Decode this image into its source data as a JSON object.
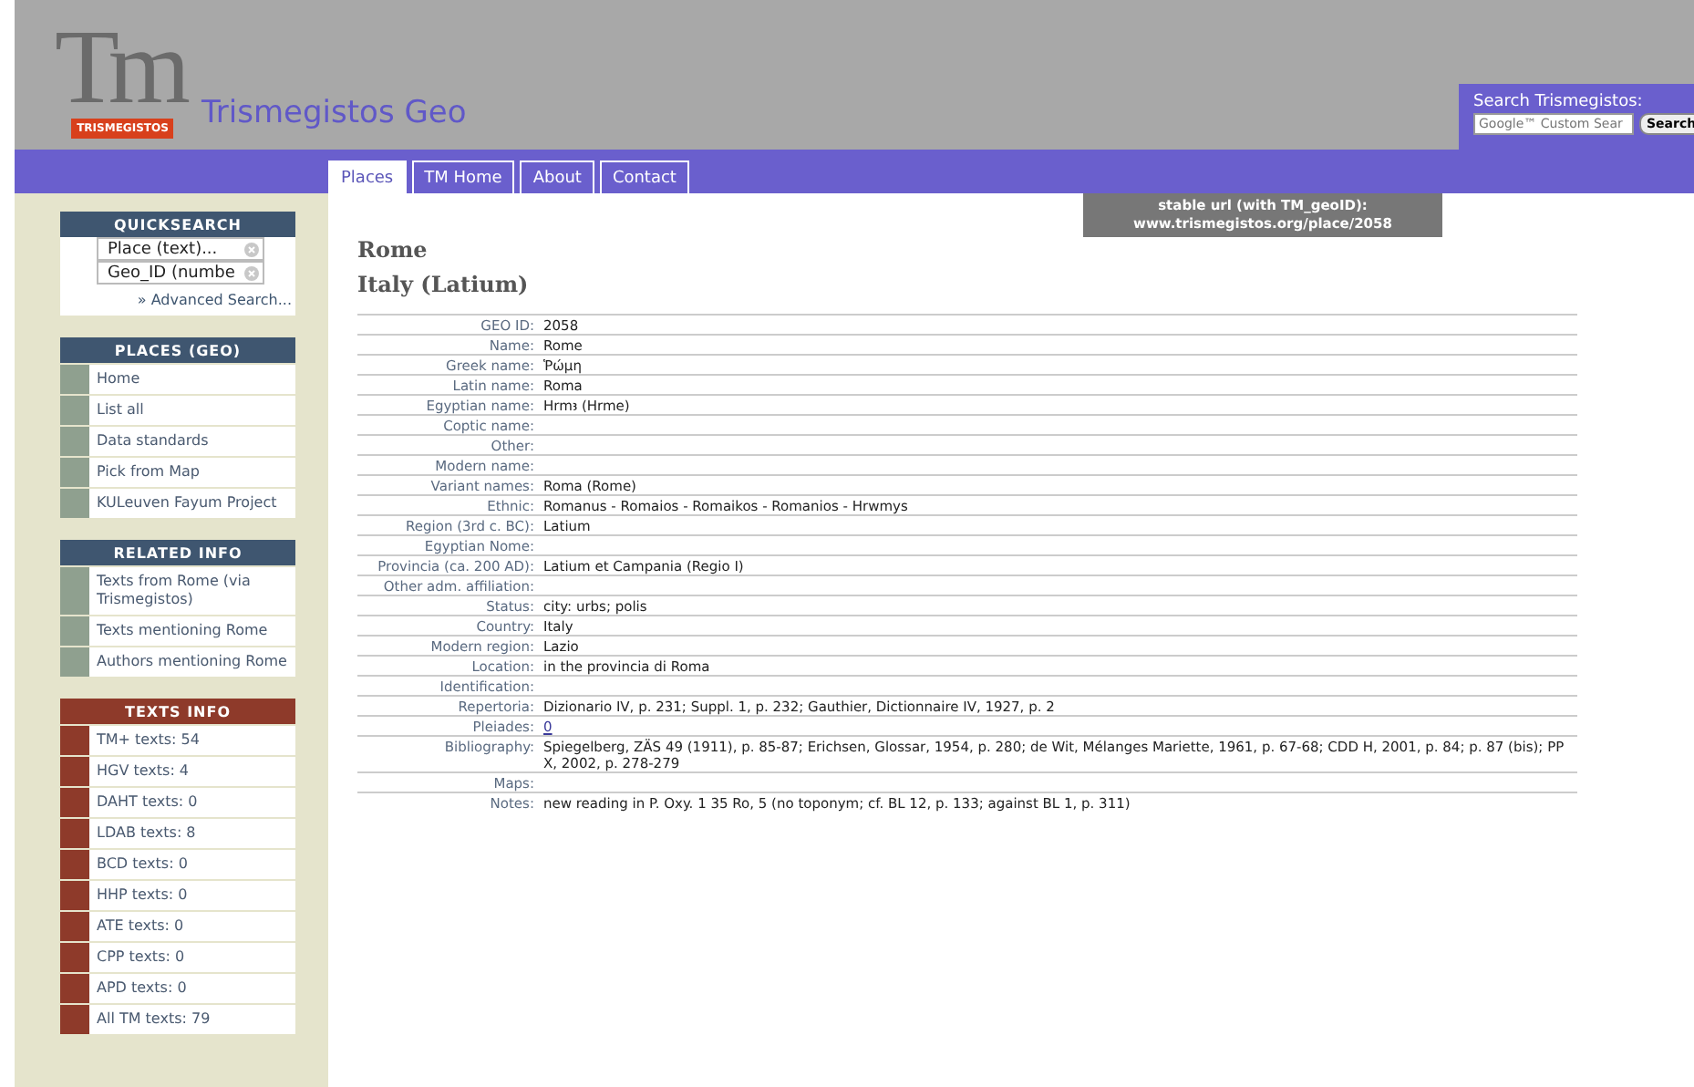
{
  "header": {
    "logo_letters": "Tm",
    "logo_label": "TRISMEGISTOS",
    "site_title": "Trismegistos Geo",
    "search": {
      "label": "Search Trismegistos:",
      "placeholder": "Google™ Custom Sear",
      "button": "Search"
    }
  },
  "tabs": [
    {
      "label": "Places",
      "selected": true
    },
    {
      "label": "TM Home",
      "selected": false
    },
    {
      "label": "About",
      "selected": false
    },
    {
      "label": "Contact",
      "selected": false
    }
  ],
  "stable_url": {
    "line_1": "stable url (with TM_geoID):",
    "line_2": "www.trismegistos.org/place/2058"
  },
  "sidebar": [
    {
      "kind": "search",
      "title": "QUICKSEARCH",
      "fields": [
        {
          "placeholder": "Place (text)..."
        },
        {
          "placeholder": "Geo_ID (numbe"
        }
      ],
      "link": "» Advanced Search..."
    },
    {
      "kind": "menu",
      "title": "PLACES (GEO)",
      "items": [
        "Home",
        "List all",
        "Data standards",
        "Pick from Map",
        "KULeuven Fayum Project"
      ]
    },
    {
      "kind": "menu",
      "title": "RELATED INFO",
      "items": [
        "Texts from Rome (via Trismegistos)",
        "Texts mentioning Rome",
        "Authors mentioning Rome"
      ]
    },
    {
      "kind": "counts",
      "title": "TEXTS INFO",
      "items": [
        "TM+ texts: 54",
        "HGV texts: 4",
        "DAHT texts: 0",
        "LDAB texts: 8",
        "BCD texts: 0",
        "HHP texts: 0",
        "ATE texts: 0",
        "CPP texts: 0",
        "APD texts: 0",
        "All TM texts: 79"
      ]
    }
  ],
  "place": {
    "title": "Rome",
    "subtitle": "Italy (Latium)",
    "fields": [
      {
        "label": "GEO ID:",
        "value": "2058"
      },
      {
        "label": "Name:",
        "value": "Rome"
      },
      {
        "label": "Greek name:",
        "value": "Ῥώμη"
      },
      {
        "label": "Latin name:",
        "value": "Roma"
      },
      {
        "label": "Egyptian name:",
        "value": "Hrmꜣ (Hrme)"
      },
      {
        "label": "Coptic name:"
      },
      {
        "label": "Other:"
      },
      {
        "label": "Modern name:"
      },
      {
        "label": "Variant names:",
        "value": "Roma (Rome)"
      },
      {
        "label": "Ethnic:",
        "value": "Romanus - Romaios - Romaikos - Romanios - Hrwmys"
      },
      {
        "label": "Region (3rd c. BC):",
        "value": "Latium"
      },
      {
        "label": "Egyptian Nome:"
      },
      {
        "label": "Provincia (ca. 200 AD):",
        "value": "Latium et Campania (Regio I)"
      },
      {
        "label": "Other adm. affiliation:"
      },
      {
        "label": "Status:",
        "value": "city: urbs; polis"
      },
      {
        "label": "Country:",
        "value": "Italy"
      },
      {
        "label": "Modern region:",
        "value": "Lazio"
      },
      {
        "label": "Location:",
        "value": "in the provincia di Roma"
      },
      {
        "label": "Identification:"
      },
      {
        "label": "Repertoria:",
        "value": "Dizionario IV, p. 231; Suppl. 1, p. 232; Gauthier, Dictionnaire IV, 1927, p. 2"
      },
      {
        "label": "Pleiades:",
        "value": "0",
        "kind": "link"
      },
      {
        "label": "Bibliography:",
        "value": "Spiegelberg, ZÄS 49 (1911), p. 85-87; Erichsen, Glossar, 1954, p. 280; de Wit, Mélanges Mariette, 1961, p. 67-68; CDD H, 2001, p. 84; p. 87 (bis); PP X, 2002, p. 278-279"
      },
      {
        "label": "Maps:"
      },
      {
        "label": "Notes:",
        "value": "new reading in P. Oxy. 1 35 Ro, 5 (no toponym; cf. BL 12, p. 133; against BL 1, p. 311)"
      }
    ]
  }
}
